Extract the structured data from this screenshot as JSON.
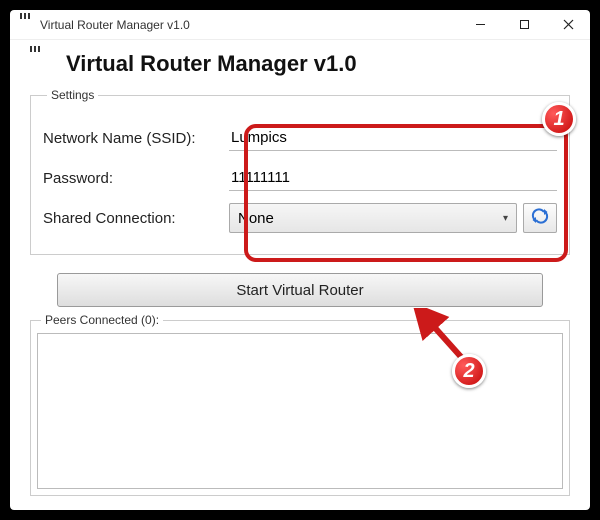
{
  "window": {
    "title": "Virtual Router Manager v1.0"
  },
  "header": {
    "title": "Virtual Router Manager v1.0"
  },
  "settings": {
    "legend": "Settings",
    "ssid_label": "Network Name (SSID):",
    "ssid_value": "Lumpics",
    "password_label": "Password:",
    "password_value": "11111111",
    "shared_label": "Shared Connection:",
    "shared_value": "None"
  },
  "actions": {
    "start_label": "Start Virtual Router"
  },
  "peers": {
    "legend": "Peers Connected (0):"
  },
  "annotations": {
    "badge1": "1",
    "badge2": "2"
  }
}
